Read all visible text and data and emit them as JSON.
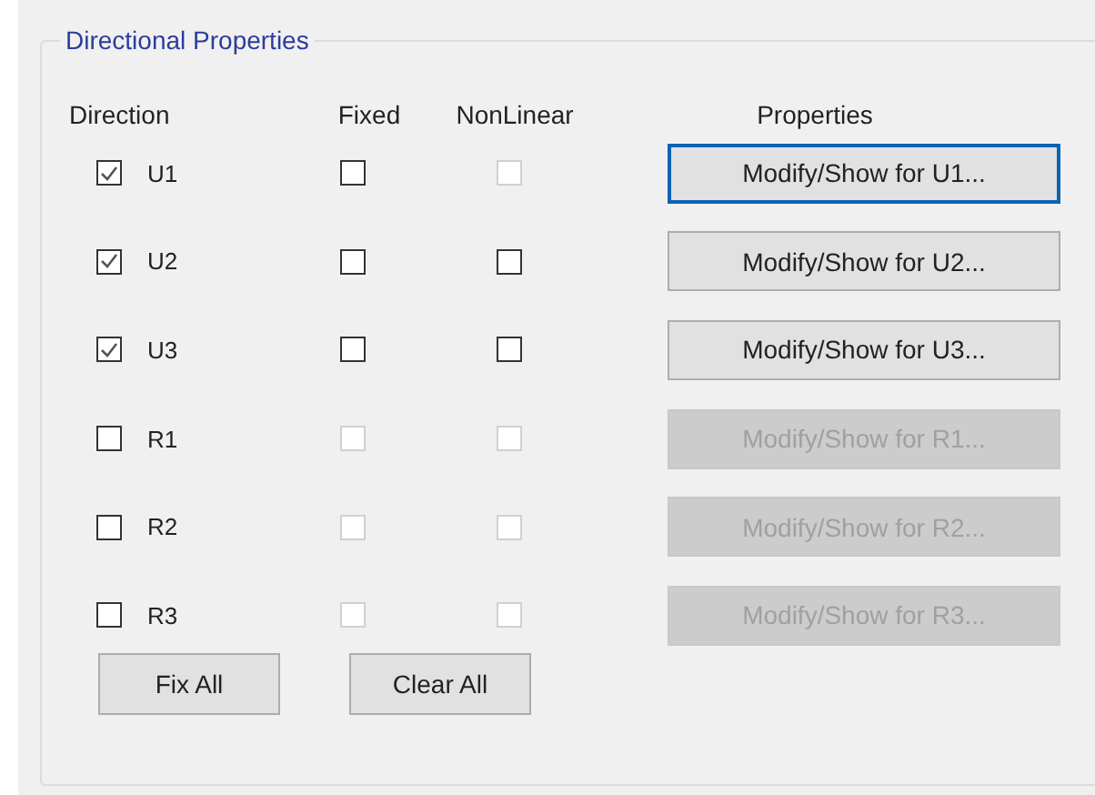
{
  "group": {
    "title": "Directional Properties"
  },
  "headers": [
    "Direction",
    "Fixed",
    "NonLinear",
    "Properties"
  ],
  "rows": [
    {
      "label": "U1",
      "checked": true,
      "fixed": {
        "checked": false,
        "disabled": false
      },
      "nonlinear": {
        "checked": false,
        "disabled": true
      },
      "button": {
        "label": "Modify/Show for U1...",
        "disabled": false,
        "focused": true
      }
    },
    {
      "label": "U2",
      "checked": true,
      "fixed": {
        "checked": false,
        "disabled": false
      },
      "nonlinear": {
        "checked": false,
        "disabled": false
      },
      "button": {
        "label": "Modify/Show for U2...",
        "disabled": false,
        "focused": false
      }
    },
    {
      "label": "U3",
      "checked": true,
      "fixed": {
        "checked": false,
        "disabled": false
      },
      "nonlinear": {
        "checked": false,
        "disabled": false
      },
      "button": {
        "label": "Modify/Show for U3...",
        "disabled": false,
        "focused": false
      }
    },
    {
      "label": "R1",
      "checked": false,
      "fixed": {
        "checked": false,
        "disabled": true
      },
      "nonlinear": {
        "checked": false,
        "disabled": true
      },
      "button": {
        "label": "Modify/Show for R1...",
        "disabled": true,
        "focused": false
      }
    },
    {
      "label": "R2",
      "checked": false,
      "fixed": {
        "checked": false,
        "disabled": true
      },
      "nonlinear": {
        "checked": false,
        "disabled": true
      },
      "button": {
        "label": "Modify/Show for R2...",
        "disabled": true,
        "focused": false
      }
    },
    {
      "label": "R3",
      "checked": false,
      "fixed": {
        "checked": false,
        "disabled": true
      },
      "nonlinear": {
        "checked": false,
        "disabled": true
      },
      "button": {
        "label": "Modify/Show for R3...",
        "disabled": true,
        "focused": false
      }
    }
  ],
  "actions": [
    "Fix All",
    "Clear All"
  ]
}
